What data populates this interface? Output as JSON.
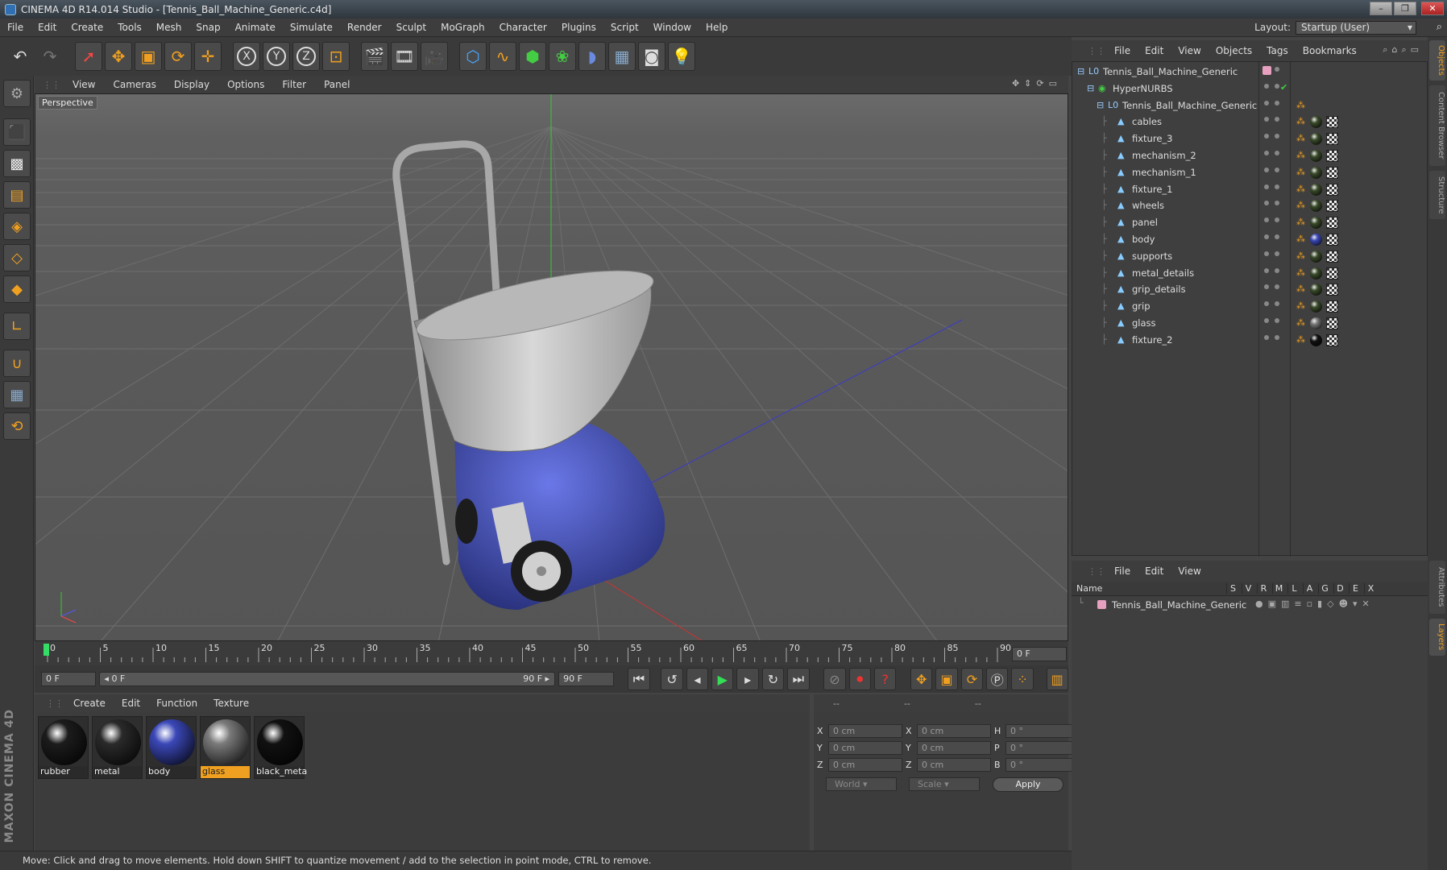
{
  "window": {
    "title": "CINEMA 4D R14.014 Studio - [Tennis_Ball_Machine_Generic.c4d]",
    "controls": [
      "–",
      "❐",
      "✕"
    ]
  },
  "menubar": {
    "items": [
      "File",
      "Edit",
      "Create",
      "Tools",
      "Mesh",
      "Snap",
      "Animate",
      "Simulate",
      "Render",
      "Sculpt",
      "MoGraph",
      "Character",
      "Plugins",
      "Script",
      "Window",
      "Help"
    ],
    "layout_label": "Layout:",
    "layout_value": "Startup (User)"
  },
  "toolbar": {
    "axis_x": "X",
    "axis_y": "Y",
    "axis_z": "Z"
  },
  "viewport": {
    "menu": [
      "View",
      "Cameras",
      "Display",
      "Options",
      "Filter",
      "Panel"
    ],
    "label": "Perspective"
  },
  "timeline": {
    "ticks": [
      "0",
      "5",
      "10",
      "15",
      "20",
      "25",
      "30",
      "35",
      "40",
      "45",
      "50",
      "55",
      "60",
      "65",
      "70",
      "75",
      "80",
      "85",
      "90"
    ],
    "current_frame": "0 F",
    "start_field": "0 F",
    "range_start": "◂ 0 F",
    "range_end": "90 F ▸",
    "end_field": "90 F"
  },
  "material_manager": {
    "menu": [
      "Create",
      "Edit",
      "Function",
      "Texture"
    ],
    "materials": [
      {
        "name": "rubber",
        "color": "#1c1c1c",
        "selected": false
      },
      {
        "name": "metal",
        "color": "#2a2a2a",
        "selected": false
      },
      {
        "name": "body",
        "color": "#3b48b8",
        "selected": false
      },
      {
        "name": "glass",
        "color": "#7a7a7a",
        "selected": true
      },
      {
        "name": "black_meta",
        "color": "#111111",
        "selected": false
      }
    ]
  },
  "coord_manager": {
    "headers": [
      "--",
      "--",
      "--"
    ],
    "rows": [
      {
        "a1": "X",
        "v1": "0 cm",
        "a2": "X",
        "v2": "0 cm",
        "a3": "H",
        "v3": "0 °"
      },
      {
        "a1": "Y",
        "v1": "0 cm",
        "a2": "Y",
        "v2": "0 cm",
        "a3": "P",
        "v3": "0 °"
      },
      {
        "a1": "Z",
        "v1": "0 cm",
        "a2": "Z",
        "v2": "0 cm",
        "a3": "B",
        "v3": "0 °"
      }
    ],
    "world": "World",
    "scale": "Scale",
    "apply": "Apply"
  },
  "status": "Move: Click and drag to move elements. Hold down SHIFT to quantize movement / add to the selection in point mode, CTRL to remove.",
  "object_manager": {
    "menu": [
      "File",
      "Edit",
      "View",
      "Objects",
      "Tags",
      "Bookmarks"
    ],
    "objects": [
      {
        "name": "Tennis_Ball_Machine_Generic",
        "level": 0,
        "kind": "null",
        "tag": "layer"
      },
      {
        "name": "HyperNURBS",
        "level": 1,
        "kind": "nurbs",
        "tag": "check"
      },
      {
        "name": "Tennis_Ball_Machine_Generic",
        "level": 2,
        "kind": "null",
        "tag": "phong"
      },
      {
        "name": "cables",
        "level": 3,
        "kind": "poly",
        "tag": "mat",
        "mat": "#3a4a2a"
      },
      {
        "name": "fixture_3",
        "level": 3,
        "kind": "poly",
        "tag": "mat",
        "mat": "#3a4a2a"
      },
      {
        "name": "mechanism_2",
        "level": 3,
        "kind": "poly",
        "tag": "mat",
        "mat": "#3a4a2a"
      },
      {
        "name": "mechanism_1",
        "level": 3,
        "kind": "poly",
        "tag": "mat",
        "mat": "#3a4a2a"
      },
      {
        "name": "fixture_1",
        "level": 3,
        "kind": "poly",
        "tag": "mat",
        "mat": "#3a4a2a"
      },
      {
        "name": "wheels",
        "level": 3,
        "kind": "poly",
        "tag": "mat",
        "mat": "#3a4a2a"
      },
      {
        "name": "panel",
        "level": 3,
        "kind": "poly",
        "tag": "mat",
        "mat": "#3a4a2a"
      },
      {
        "name": "body",
        "level": 3,
        "kind": "poly",
        "tag": "mat",
        "mat": "#3b48b8"
      },
      {
        "name": "supports",
        "level": 3,
        "kind": "poly",
        "tag": "mat",
        "mat": "#3a4a2a"
      },
      {
        "name": "metal_details",
        "level": 3,
        "kind": "poly",
        "tag": "mat",
        "mat": "#3a4a2a"
      },
      {
        "name": "grip_details",
        "level": 3,
        "kind": "poly",
        "tag": "mat",
        "mat": "#3a4a2a"
      },
      {
        "name": "grip",
        "level": 3,
        "kind": "poly",
        "tag": "mat",
        "mat": "#3a4a2a"
      },
      {
        "name": "glass",
        "level": 3,
        "kind": "poly",
        "tag": "mat",
        "mat": "#777777"
      },
      {
        "name": "fixture_2",
        "level": 3,
        "kind": "poly",
        "tag": "mat",
        "mat": "#111111"
      }
    ]
  },
  "layer_manager": {
    "menu": [
      "File",
      "Edit",
      "View"
    ],
    "columns": [
      "Name",
      "S",
      "V",
      "R",
      "M",
      "L",
      "A",
      "G",
      "D",
      "E",
      "X"
    ],
    "layers": [
      {
        "name": "Tennis_Ball_Machine_Generic",
        "color": "#e8a0c0"
      }
    ]
  },
  "side_tabs": [
    "Objects",
    "Content Browser",
    "Structure",
    "Attributes",
    "Layers"
  ]
}
